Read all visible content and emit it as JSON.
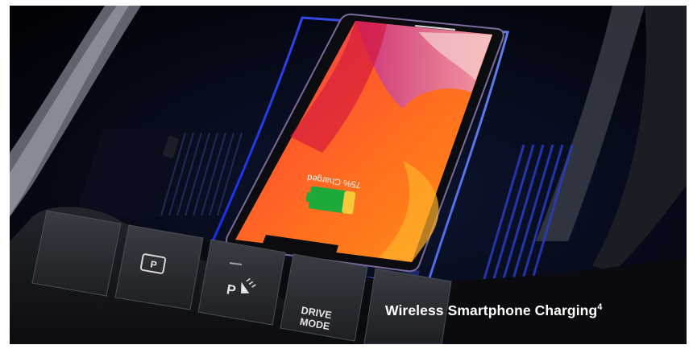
{
  "caption": {
    "title": "Wireless Smartphone Charging",
    "footnote": "4"
  },
  "phone": {
    "charge_status": "75% Charged",
    "charge_level": 0.75
  },
  "buttons": {
    "parking_assist_label": "P",
    "rear_sensor_label": "P",
    "drive_mode_line1": "DRIVE",
    "drive_mode_line2": "MODE"
  },
  "colors": {
    "ambient_blue": "#3a5cff",
    "battery_green": "#1eaa3a",
    "caption_text": "#ffffff"
  }
}
